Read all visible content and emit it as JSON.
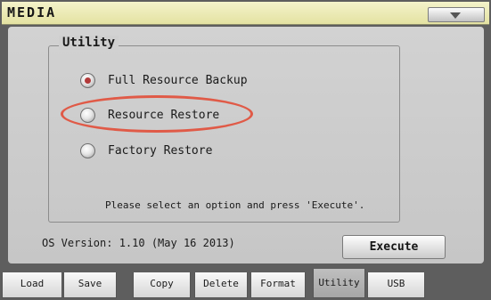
{
  "window": {
    "title": "MEDIA"
  },
  "group": {
    "title": "Utility"
  },
  "options": [
    {
      "label": "Full Resource Backup",
      "selected": true
    },
    {
      "label": "Resource Restore",
      "selected": false
    },
    {
      "label": "Factory Restore",
      "selected": false
    }
  ],
  "hint": "Please select an option and press 'Execute'.",
  "os_version": "OS Version: 1.10 (May 16 2013)",
  "execute_label": "Execute",
  "tabs": [
    {
      "label": "Load",
      "active": false
    },
    {
      "label": "Save",
      "active": false
    },
    {
      "label": "Copy",
      "active": false
    },
    {
      "label": "Delete",
      "active": false
    },
    {
      "label": "Format",
      "active": false
    },
    {
      "label": "Utility",
      "active": true
    },
    {
      "label": "USB",
      "active": false
    }
  ],
  "icons": {
    "menu": "triangle-down-icon"
  },
  "colors": {
    "title_bar": "#eeedbc",
    "panel": "#cccccc",
    "selected_radio": "#b23a3a",
    "highlight_ring": "#e05a47"
  }
}
